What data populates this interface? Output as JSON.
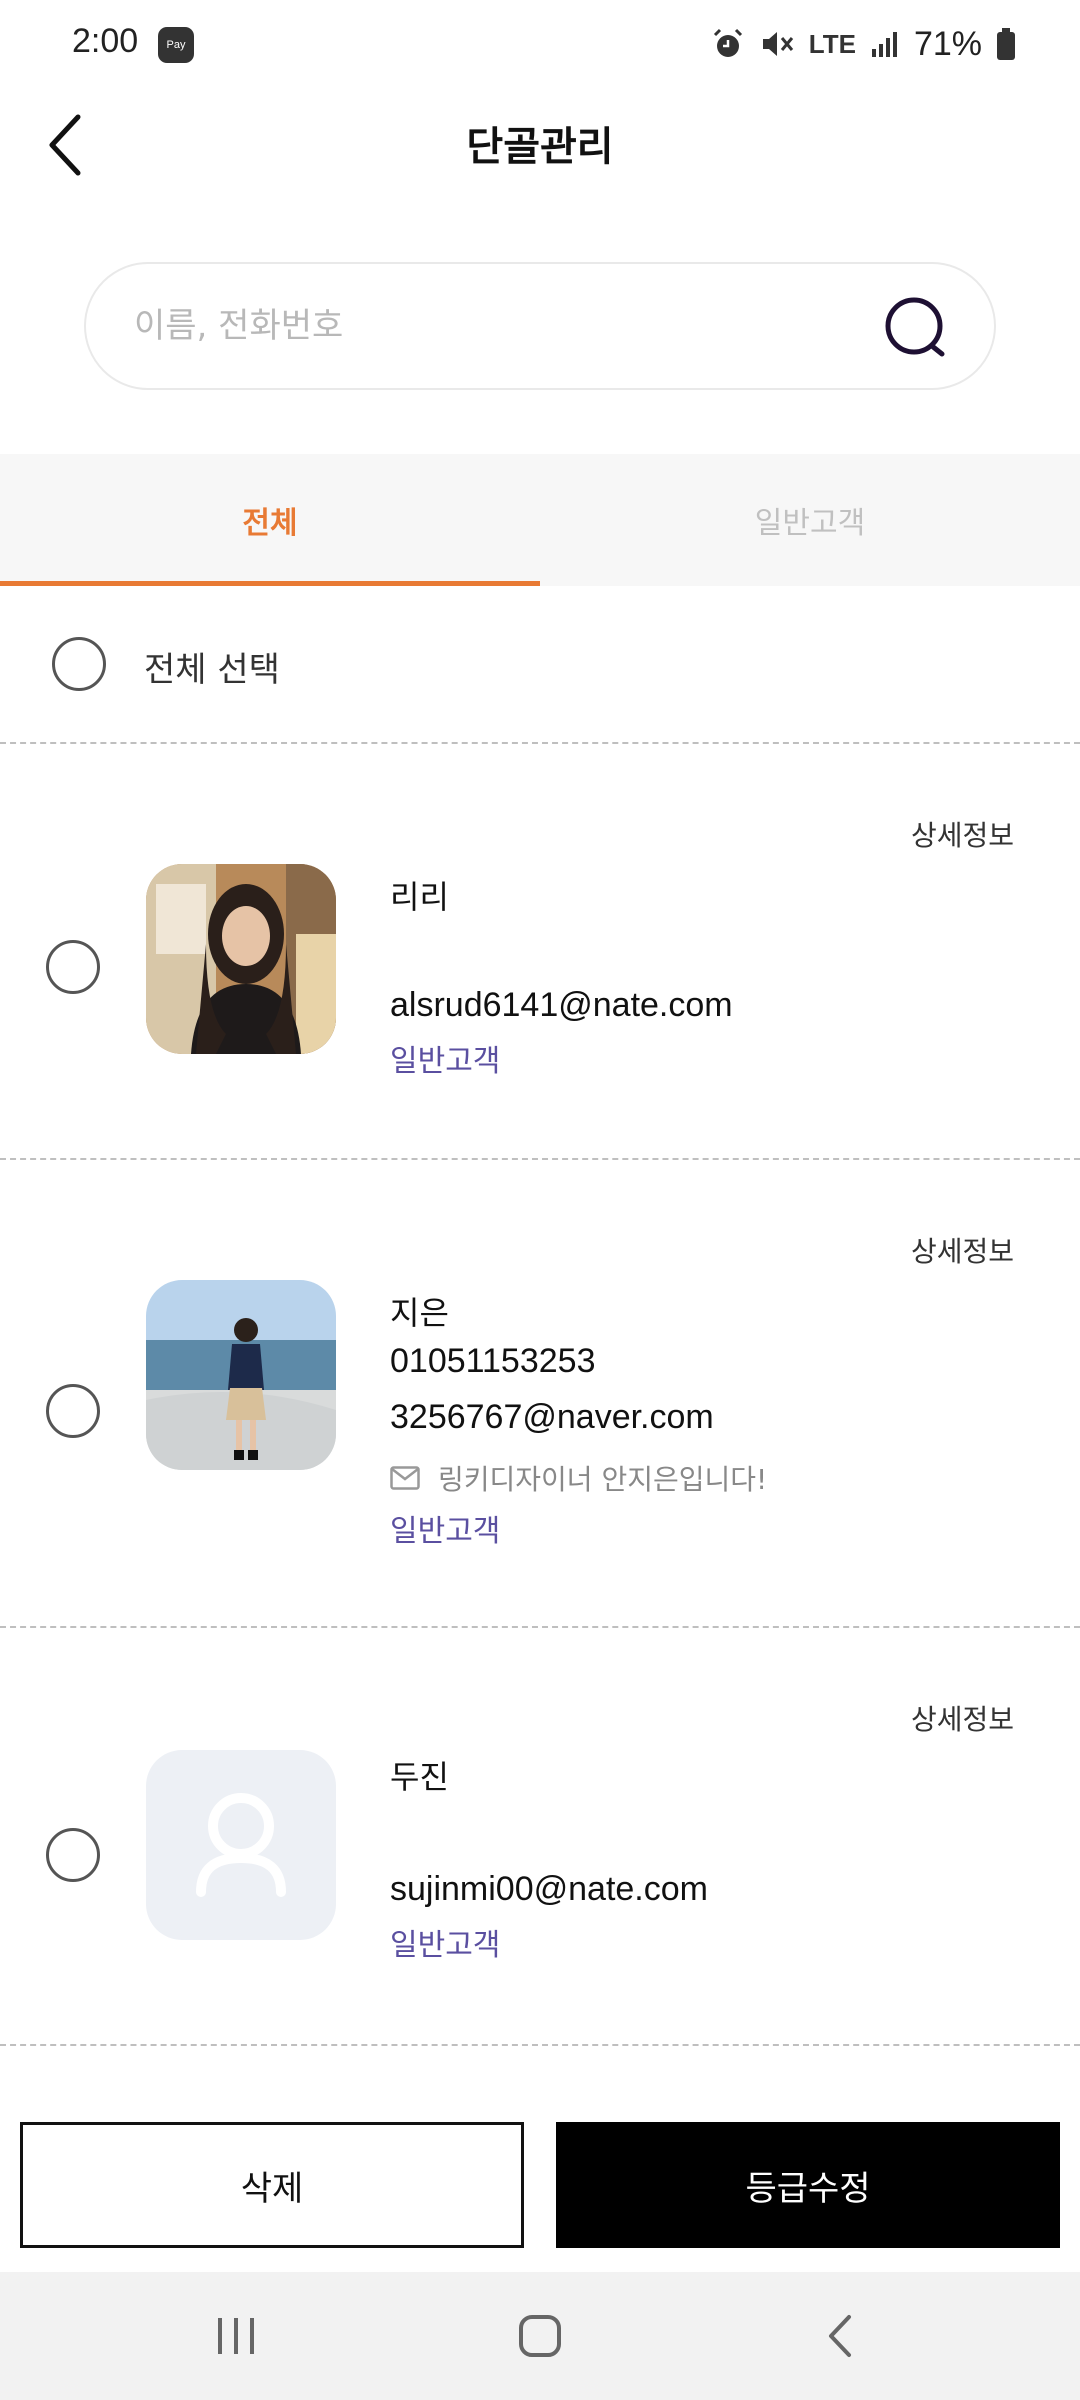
{
  "status_bar": {
    "time": "2:00",
    "pay_badge": "Pay",
    "network": "LTE",
    "battery_percent": "71%",
    "icons": [
      "alarm-icon",
      "mute-icon",
      "signal-icon",
      "battery-icon"
    ]
  },
  "header": {
    "title": "단골관리",
    "back_icon": "chevron-left-icon"
  },
  "search": {
    "placeholder": "이름, 전화번호",
    "value": "",
    "icon": "search-icon"
  },
  "tabs": [
    {
      "label": "전체",
      "active": true
    },
    {
      "label": "일반고객",
      "active": false
    }
  ],
  "select_all": {
    "label": "전체 선택",
    "checked": false
  },
  "customers": [
    {
      "name": "리리",
      "phone": "",
      "email": "alsrud6141@nate.com",
      "memo": "",
      "grade": "일반고객",
      "detail_label": "상세정보",
      "avatar": "photo",
      "checked": false
    },
    {
      "name": "지은",
      "phone": "01051153253",
      "email": "3256767@naver.com",
      "memo": "링키디자이너 안지은입니다!",
      "grade": "일반고객",
      "detail_label": "상세정보",
      "avatar": "photo",
      "checked": false
    },
    {
      "name": "두진",
      "phone": "",
      "email": "sujinmi00@nate.com",
      "memo": "",
      "grade": "일반고객",
      "detail_label": "상세정보",
      "avatar": "default-user-icon",
      "checked": false
    }
  ],
  "actions": {
    "delete_label": "삭제",
    "edit_grade_label": "등급수정"
  },
  "colors": {
    "accent": "#e87a34",
    "grade_text": "#5a4fa0",
    "primary_button": "#000000"
  }
}
